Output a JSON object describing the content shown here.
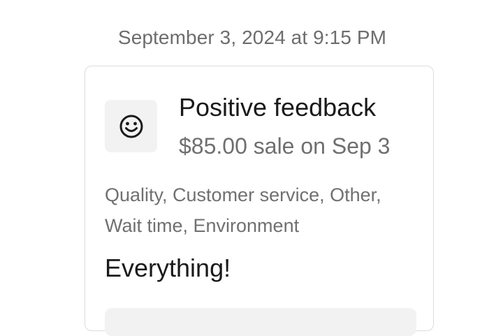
{
  "timestamp": "September 3, 2024 at 9:15 PM",
  "feedback": {
    "icon": "smiley-icon",
    "title": "Positive feedback",
    "subtitle": "$85.00 sale on Sep 3",
    "tags": "Quality, Customer service, Other, Wait time, Environment",
    "comment": "Everything!"
  }
}
